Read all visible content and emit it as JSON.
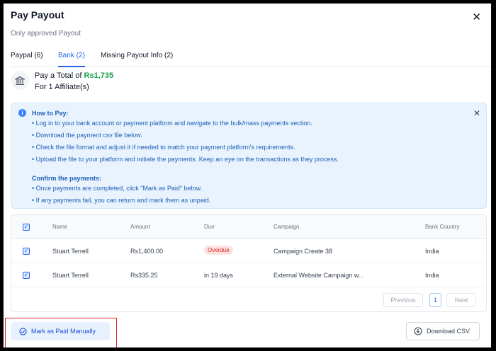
{
  "modal": {
    "title": "Pay Payout",
    "subtitle": "Only approved Payout",
    "close": "✕"
  },
  "tabs": [
    {
      "label": "Paypal (6)"
    },
    {
      "label": "Bank (2)",
      "active": true
    },
    {
      "label": "Missing Payout Info (2)"
    }
  ],
  "summary": {
    "prefix": "Pay a Total of ",
    "amount": "Rs1,735",
    "line2": "For 1 Affiliate(s)",
    "icon": "bank-icon"
  },
  "info": {
    "icon": "i",
    "close": "✕",
    "heading1": "How to Pay:",
    "steps": [
      "• Log in to your bank account or payment platform and navigate to the bulk/mass payments section.",
      "• Download the payment csv file below.",
      "• Check the file format and adjust it if needed to match your payment platform's requirements.",
      "• Upload the file to your platform and initiate the payments. Keep an eye on the transactions as they process."
    ],
    "heading2": "Confirm the payments:",
    "confirm": [
      "• Once payments are completed, click \"Mark as Paid\" below.",
      "• If any payments fail, you can return and mark them as unpaid."
    ]
  },
  "table": {
    "columns": [
      "Name",
      "Amount",
      "Due",
      "Campaign",
      "Bank Country"
    ],
    "rows": [
      {
        "name": "Stuart Terrell",
        "amount": "Rs1,400.00",
        "due": "Overdue",
        "campaign": "Campaign Create 38",
        "country": "India"
      },
      {
        "name": "Stuart Terrell",
        "amount": "Rs335.25",
        "due": "in 19 days",
        "campaign": "External Website Campaign w...",
        "country": "India"
      }
    ],
    "pagination": {
      "previous": "Previous",
      "page": "1",
      "next": "Next"
    }
  },
  "footer": {
    "mark_paid": "Mark as Paid Manually",
    "download": "Download CSV"
  },
  "colors": {
    "accent": "#2563eb",
    "amount": "#16a34a",
    "overdue": "#dc2626",
    "info_bg": "#e8f3fd"
  }
}
